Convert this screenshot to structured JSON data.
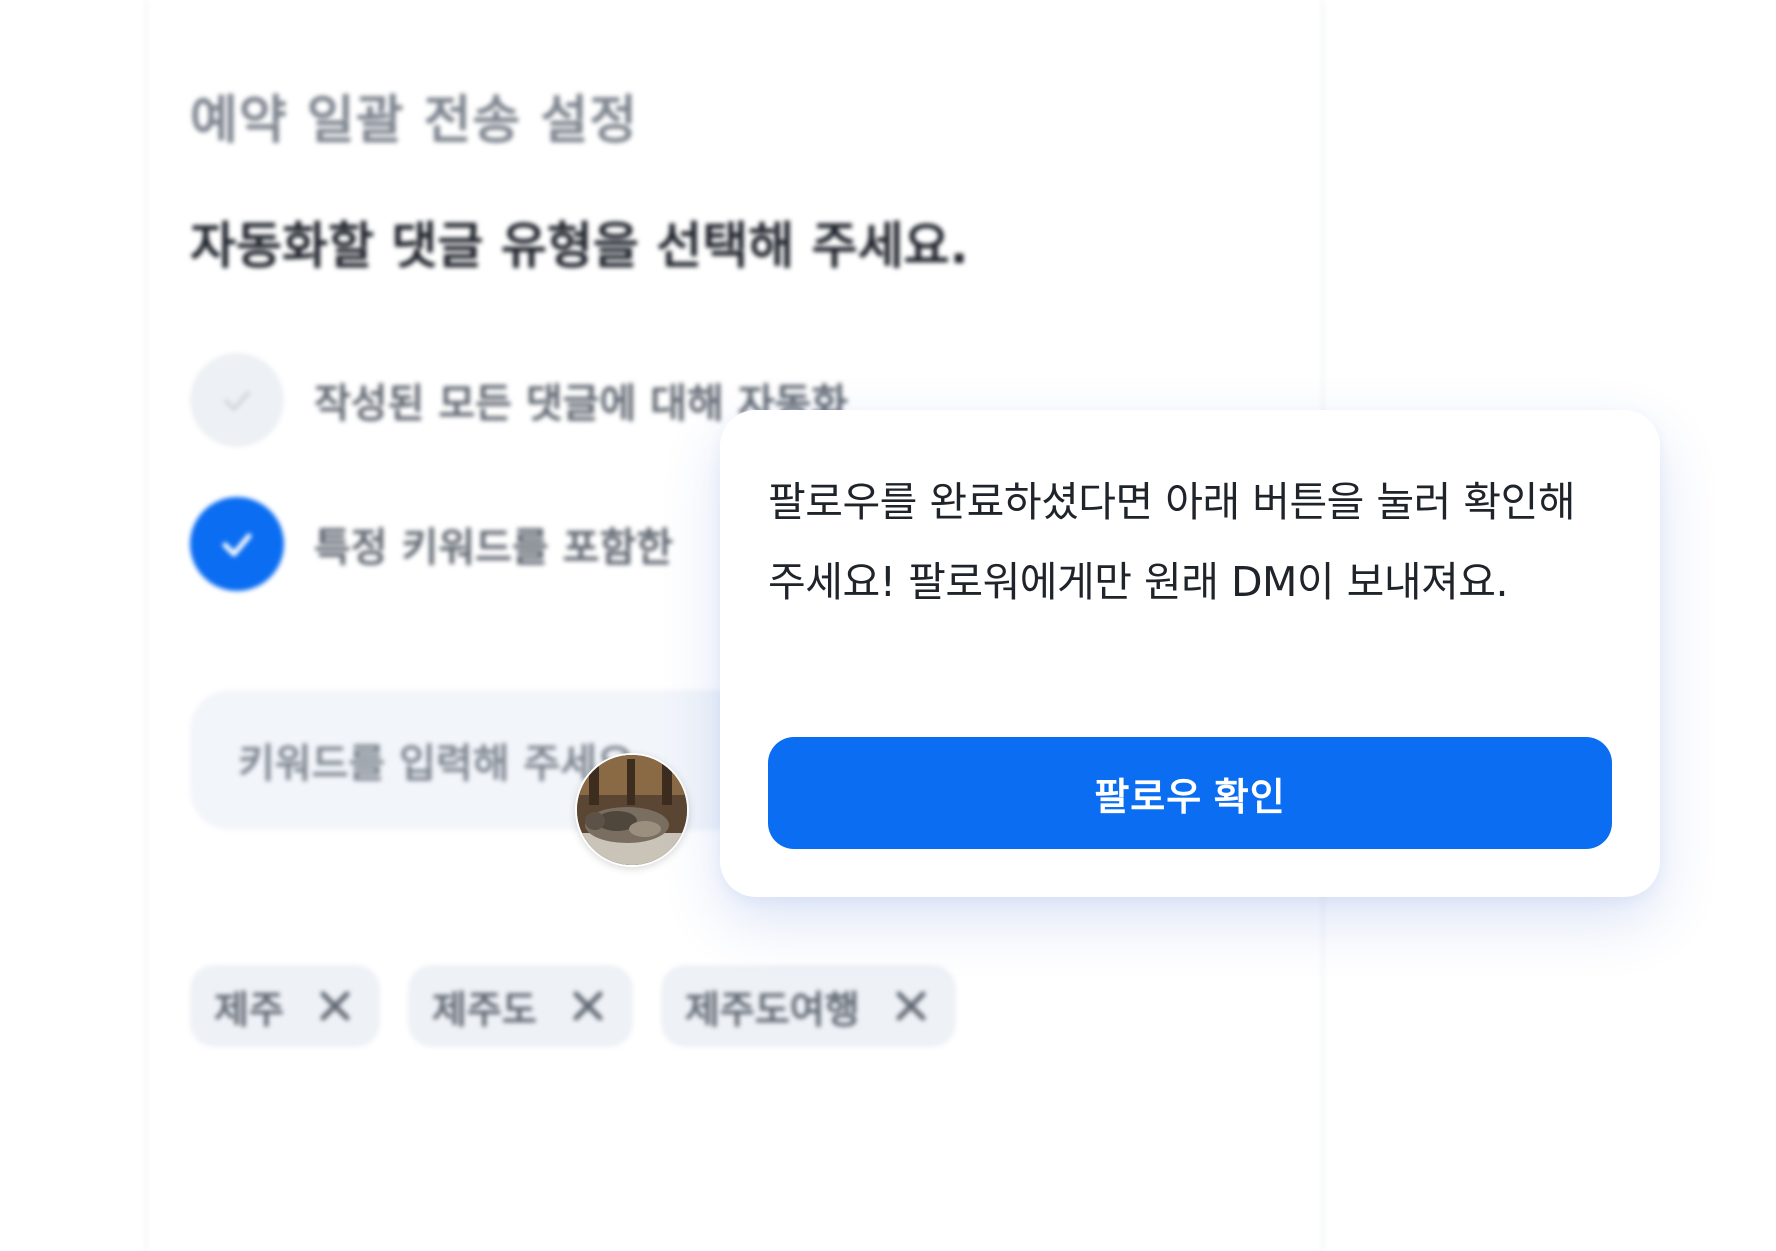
{
  "settings": {
    "title": "예약 일괄 전송 설정",
    "subtitle": "자동화할 댓글 유형을 선택해 주세요.",
    "options": [
      {
        "label": "작성된 모든 댓글에 대해 자동화",
        "checked": false
      },
      {
        "label": "특정 키워드를 포함한",
        "checked": true
      }
    ],
    "keyword_input": {
      "placeholder": "키워드를 입력해 주세요."
    },
    "keywords": [
      {
        "label": "제주"
      },
      {
        "label": "제주도"
      },
      {
        "label": "제주도여행"
      }
    ]
  },
  "popup": {
    "message": "팔로우를 완료하셨다면 아래 버튼을 눌러 확인해 주세요! 팔로워에게만 원래 DM이 보내져요.",
    "button_label": "팔로우 확인"
  },
  "colors": {
    "accent": "#0b6df2",
    "text_dark": "#1f242b",
    "muted": "#7d848e",
    "chip_bg": "#eef1f6"
  },
  "icons": {
    "check": "check-icon",
    "close": "close-icon"
  }
}
